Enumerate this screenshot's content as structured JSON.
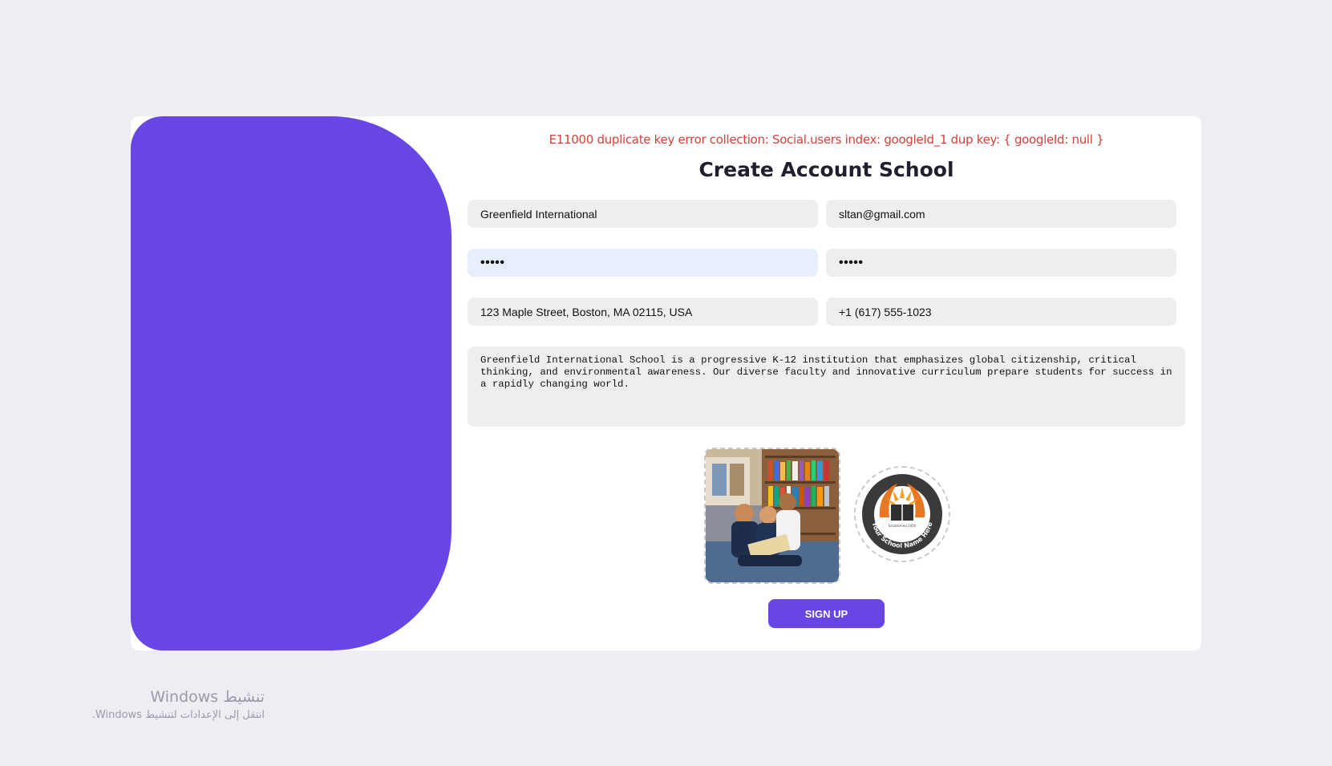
{
  "form": {
    "error_message": "E11000 duplicate key error collection: Social.users index: googleId_1 dup key: { googleId: null }",
    "title": "Create Account School",
    "school_name": "Greenfield International",
    "email": "sltan@gmail.com",
    "password_mask": "•••••",
    "confirm_password_mask": "•••••",
    "address": "123 Maple Street, Boston, MA 02115, USA",
    "phone": "+1 (617) 555-1023",
    "description": "Greenfield International School is a progressive K-12 institution that emphasizes global citizenship, critical thinking, and environmental awareness. Our diverse faculty and innovative curriculum prepare students for success in a rapidly changing world.",
    "logo_text": "Your School Name Here",
    "logo_established": "Established 2000",
    "signup_label": "SIGN UP"
  },
  "watermark": {
    "title": "تنشيط Windows",
    "subtitle": "انتقل إلى الإعدادات لتنشيط Windows."
  },
  "colors": {
    "accent": "#6746e3",
    "error": "#d3413a",
    "background": "#efedf3"
  }
}
